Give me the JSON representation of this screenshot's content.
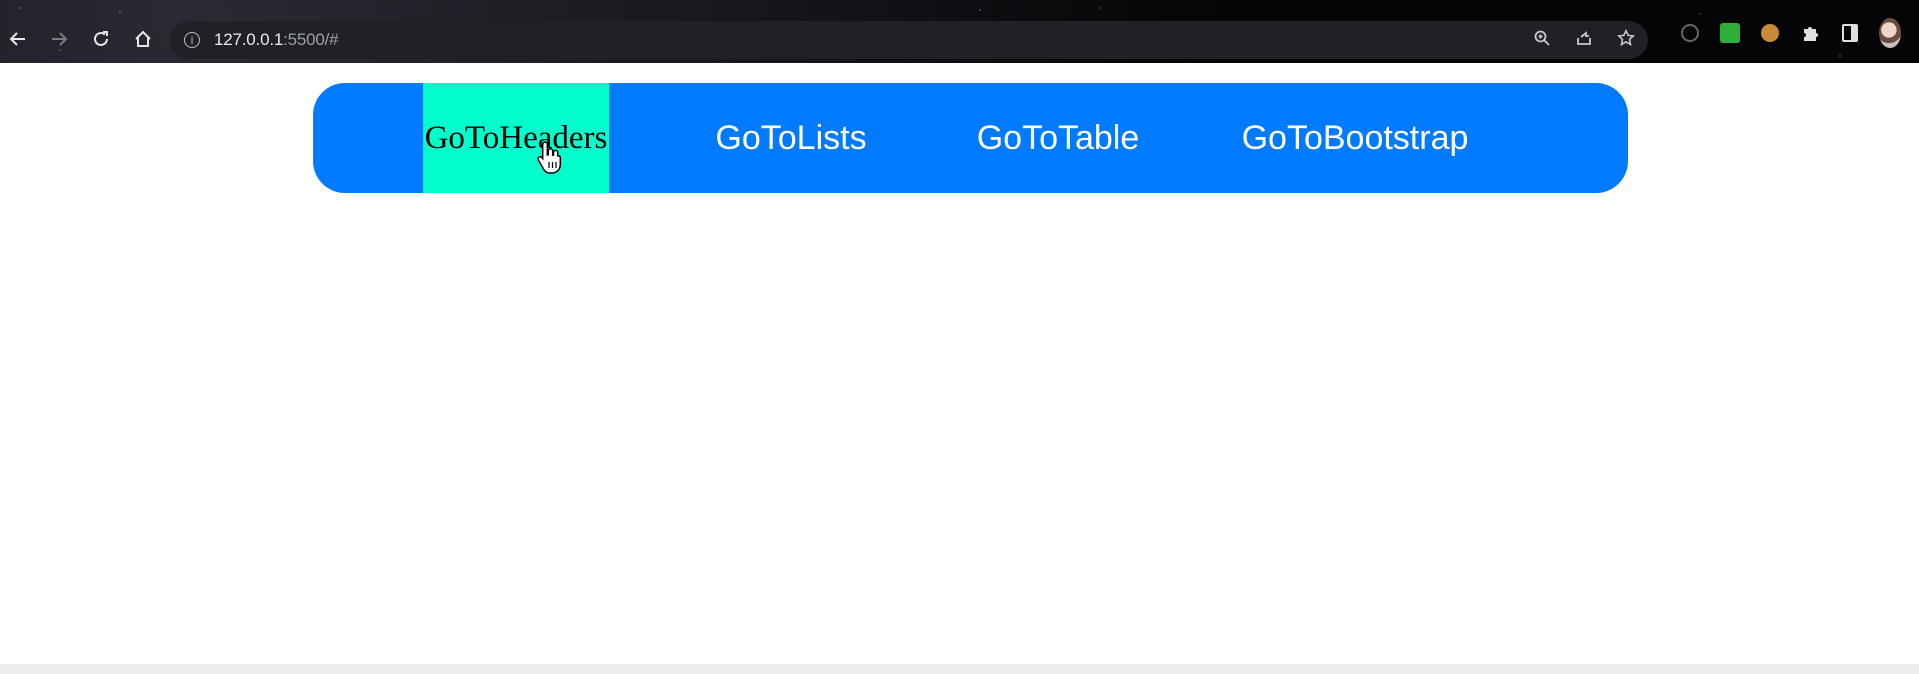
{
  "browser": {
    "url_host": "127.0.0.1",
    "url_rest": ":5500/#",
    "icons": {
      "back": "back-arrow-icon",
      "forward": "forward-arrow-icon",
      "reload": "reload-icon",
      "home": "home-icon",
      "site_info": "info-icon",
      "zoom": "zoom-icon",
      "share": "share-icon",
      "bookmark": "star-icon"
    }
  },
  "navbar": {
    "background": "#007bff",
    "active_background": "#00ffcc",
    "links": [
      {
        "label": "GoToHeaders",
        "active": true
      },
      {
        "label": "GoToLists",
        "active": false
      },
      {
        "label": "GoToTable",
        "active": false
      },
      {
        "label": "GoToBootstrap",
        "active": false
      }
    ]
  }
}
